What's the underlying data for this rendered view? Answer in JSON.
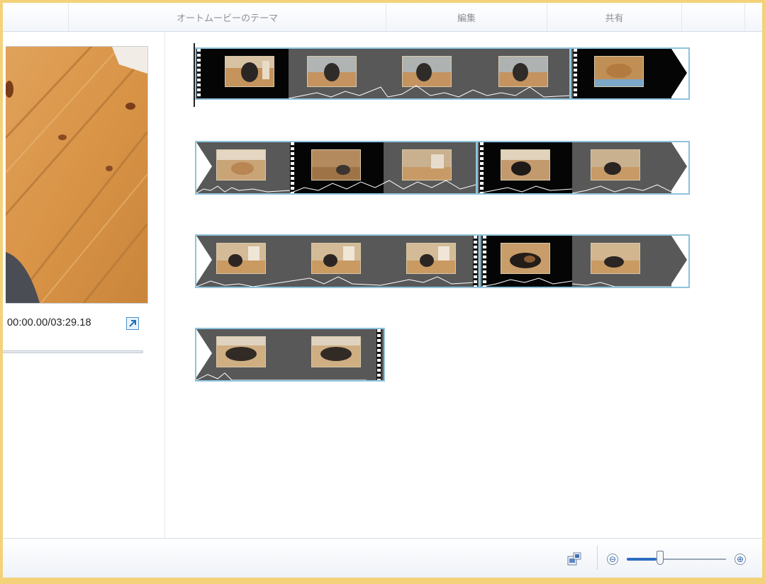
{
  "ribbon": {
    "tabs": [
      {
        "label": "オートムービーのテーマ"
      },
      {
        "label": "編集"
      },
      {
        "label": "共有"
      }
    ]
  },
  "preview": {
    "timecode": "00:00.00/03:29.18",
    "popout_icon": "popout-arrow-icon"
  },
  "storyboard": {
    "rows": 4,
    "clip_border_color": "#8fc3dc",
    "selected": true
  },
  "statusbar": {
    "thumbnail_size_icon": "thumbnail-size-icon",
    "zoom_out_label": "⊖",
    "zoom_in_label": "⊕",
    "zoom_level": 0.3
  },
  "colors": {
    "window_border": "#f3d27a",
    "accent": "#2c6bc2",
    "selection": "#8fc3dc"
  }
}
